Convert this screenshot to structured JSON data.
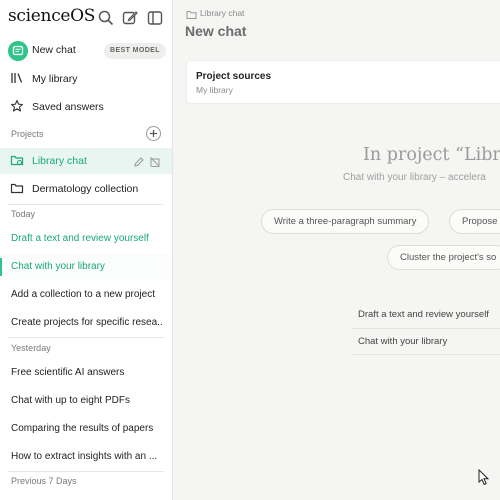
{
  "sidebar": {
    "brand": "scienceOS",
    "new_chat": {
      "label": "New chat",
      "badge": "BEST MODEL"
    },
    "nav": [
      {
        "label": "My library",
        "icon": "library-icon"
      },
      {
        "label": "Saved answers",
        "icon": "star-icon"
      }
    ],
    "projects_label": "Projects",
    "projects": [
      {
        "label": "Library chat",
        "icon": "folder-sync-icon",
        "active": true
      },
      {
        "label": "Dermatology collection",
        "icon": "folder-icon",
        "active": false
      }
    ],
    "groups": [
      {
        "label": "Today",
        "items": [
          "Draft a text and review yourself",
          "Chat with your library",
          "Add a collection to a new project",
          "Create projects for specific resea..."
        ]
      },
      {
        "label": "Yesterday",
        "items": [
          "Free scientific AI answers",
          "Chat with up to eight PDFs",
          "Comparing the results of papers",
          "How to extract insights with an ..."
        ]
      },
      {
        "label": "Previous 7 Days",
        "items": []
      }
    ]
  },
  "main": {
    "breadcrumb": "Library chat",
    "title": "New chat",
    "sources": {
      "title": "Project sources",
      "subtitle": "My library"
    },
    "heading": "In project “Libra",
    "subheading": "Chat with your library – accelera",
    "chips": [
      "Write a three-paragraph summary",
      "Propose",
      "Cluster the project's so"
    ],
    "suggestions": [
      "Draft a text and review yourself",
      "Chat with your library"
    ]
  },
  "colors": {
    "accent": "#2ec48a",
    "accent_text": "#1aa874",
    "active_bg": "#e9f5f0"
  }
}
